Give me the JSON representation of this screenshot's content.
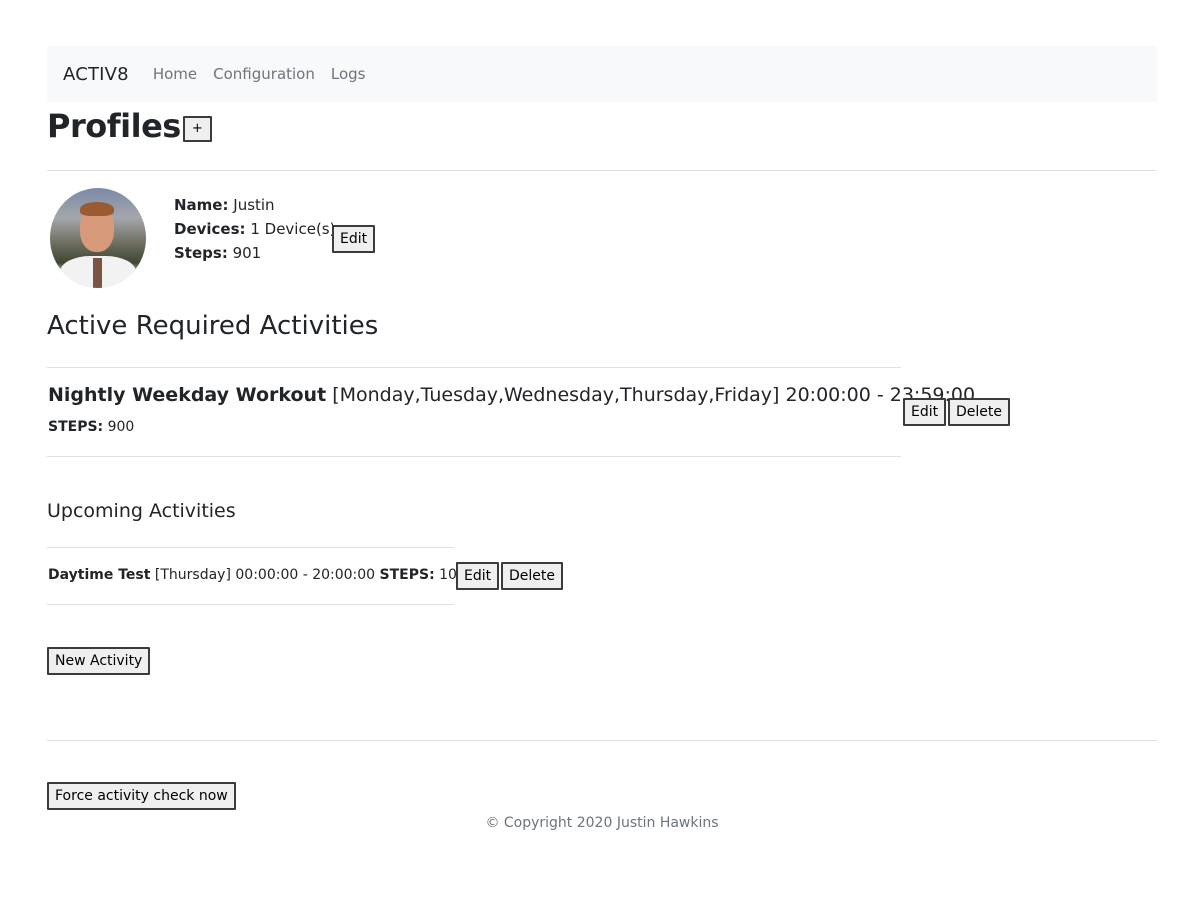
{
  "navbar": {
    "brand": "ACTIV8",
    "links": [
      "Home",
      "Configuration",
      "Logs"
    ]
  },
  "profiles": {
    "title": "Profiles",
    "add_label": "+",
    "items": [
      {
        "name_label": "Name:",
        "name": "Justin",
        "devices_label": "Devices:",
        "devices": "1 Device(s)",
        "steps_label": "Steps:",
        "steps": "901",
        "edit_label": "Edit"
      }
    ]
  },
  "required": {
    "heading": "Active Required Activities",
    "items": [
      {
        "name": "Nightly Weekday Workout",
        "days": "[Monday,Tuesday,Wednesday,Thursday,Friday]",
        "time": "20:00:00 - 23:59:00",
        "steps_label": "STEPS:",
        "steps": "900",
        "edit_label": "Edit",
        "delete_label": "Delete"
      }
    ]
  },
  "upcoming": {
    "heading": "Upcoming Activities",
    "items": [
      {
        "name": "Daytime Test",
        "days": "[Thursday]",
        "time": "00:00:00 - 20:00:00",
        "steps_label": "STEPS:",
        "steps": "1000",
        "edit_label": "Edit",
        "delete_label": "Delete"
      }
    ]
  },
  "actions": {
    "new_activity_label": "New Activity",
    "force_check_label": "Force activity check now"
  },
  "footer": {
    "copyright": "© Copyright 2020 Justin Hawkins"
  }
}
